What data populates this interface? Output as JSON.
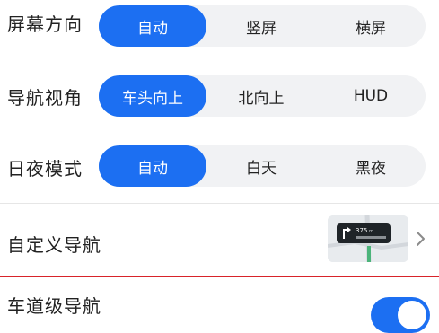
{
  "settings": {
    "orientation": {
      "label": "屏幕方向",
      "options": [
        "自动",
        "竖屏",
        "横屏"
      ],
      "selected": "自动"
    },
    "nav_view": {
      "label": "导航视角",
      "options": [
        "车头向上",
        "北向上",
        "HUD"
      ],
      "selected": "车头向上"
    },
    "day_night": {
      "label": "日夜模式",
      "options": [
        "自动",
        "白天",
        "黑夜"
      ],
      "selected": "自动"
    },
    "custom_nav": {
      "label": "自定义导航",
      "preview_distance": "375",
      "preview_unit": "m"
    },
    "lane_nav": {
      "label": "车道级导航",
      "enabled": true
    }
  },
  "colors": {
    "accent": "#1c6ff2",
    "divider_red": "#d8232a"
  }
}
